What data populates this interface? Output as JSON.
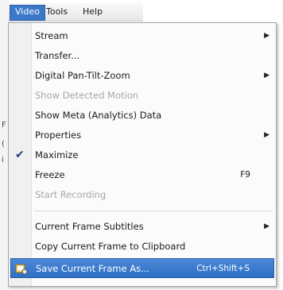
{
  "menubar": {
    "items": [
      "Video",
      "Tools",
      "Help"
    ]
  },
  "background": {
    "fragments": [
      "F",
      "(",
      "i"
    ]
  },
  "video_menu": {
    "items": [
      {
        "label": "Stream",
        "shortcut": "",
        "submenu": true,
        "enabled": true,
        "checked": false
      },
      {
        "label": "Transfer...",
        "shortcut": "",
        "submenu": false,
        "enabled": true,
        "checked": false
      },
      {
        "label": "Digital Pan-Tilt-Zoom",
        "shortcut": "",
        "submenu": true,
        "enabled": true,
        "checked": false
      },
      {
        "label": "Show Detected Motion",
        "shortcut": "",
        "submenu": false,
        "enabled": false,
        "checked": false
      },
      {
        "label": "Show Meta (Analytics) Data",
        "shortcut": "",
        "submenu": false,
        "enabled": true,
        "checked": false
      },
      {
        "label": "Properties",
        "shortcut": "",
        "submenu": true,
        "enabled": true,
        "checked": false
      },
      {
        "label": "Maximize",
        "shortcut": "",
        "submenu": false,
        "enabled": true,
        "checked": true
      },
      {
        "label": "Freeze",
        "shortcut": "F9",
        "submenu": false,
        "enabled": true,
        "checked": false
      },
      {
        "label": "Start Recording",
        "shortcut": "",
        "submenu": false,
        "enabled": false,
        "checked": false
      },
      {
        "label": "Current Frame Subtitles",
        "shortcut": "",
        "submenu": true,
        "enabled": true,
        "checked": false
      },
      {
        "label": "Copy Current Frame to Clipboard",
        "shortcut": "",
        "submenu": false,
        "enabled": true,
        "checked": false
      },
      {
        "label": "Save Current Frame As...",
        "shortcut": "Ctrl+Shift+S",
        "submenu": false,
        "enabled": true,
        "checked": false,
        "highlighted": true
      }
    ]
  },
  "colors": {
    "highlight": "#3c78c8",
    "disabled_text": "#a7a7a7",
    "menu_background": "#fbfbfb"
  }
}
